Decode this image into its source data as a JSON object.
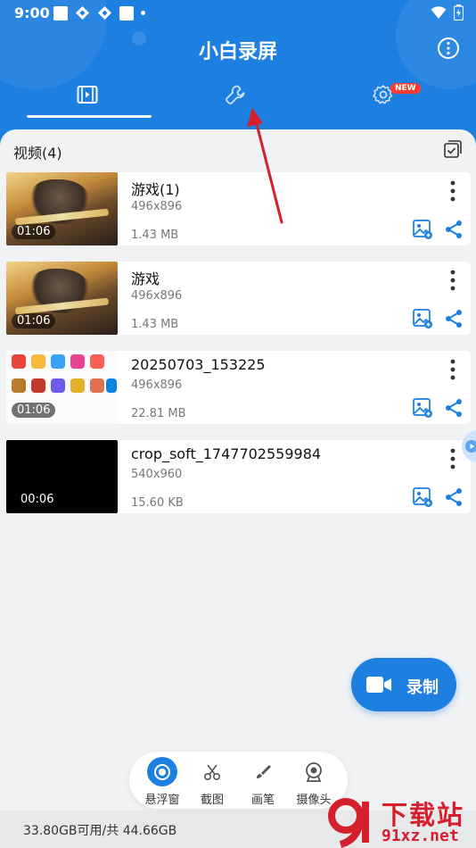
{
  "status_bar": {
    "time": "9:00"
  },
  "app": {
    "title": "小白录屏"
  },
  "tabs": [
    {
      "id": "videos",
      "icon": "video-icon",
      "active": true
    },
    {
      "id": "tools",
      "icon": "wrench-icon",
      "active": false
    },
    {
      "id": "settings",
      "icon": "gear-icon",
      "active": false,
      "badge": "NEW"
    }
  ],
  "section": {
    "title": "视频(4)"
  },
  "videos": [
    {
      "name": "游戏(1)",
      "resolution": "496x896",
      "size": "1.43 MB",
      "duration": "01:06",
      "thumbnail": "game-art"
    },
    {
      "name": "游戏",
      "resolution": "496x896",
      "size": "1.43 MB",
      "duration": "01:06",
      "thumbnail": "game-art"
    },
    {
      "name": "20250703_153225",
      "resolution": "496x896",
      "size": "22.81 MB",
      "duration": "01:06",
      "thumbnail": "app-store-screen"
    },
    {
      "name": "crop_soft_1747702559984",
      "resolution": "540x960",
      "size": "15.60 KB",
      "duration": "00:06",
      "thumbnail": "black"
    }
  ],
  "record_button": {
    "label": "录制"
  },
  "toolbar": {
    "items": [
      {
        "label": "悬浮窗",
        "icon": "floating-window-icon"
      },
      {
        "label": "截图",
        "icon": "scissors-icon"
      },
      {
        "label": "画笔",
        "icon": "brush-icon"
      },
      {
        "label": "摄像头",
        "icon": "camera-icon"
      }
    ]
  },
  "storage": {
    "text": "33.80GB可用/共 44.66GB"
  },
  "watermark": {
    "top": "下载站",
    "bottom": "91xz.net"
  },
  "colors": {
    "primary": "#1d7fe0",
    "badge": "#ff3b30",
    "arrow": "#d61f2c"
  }
}
